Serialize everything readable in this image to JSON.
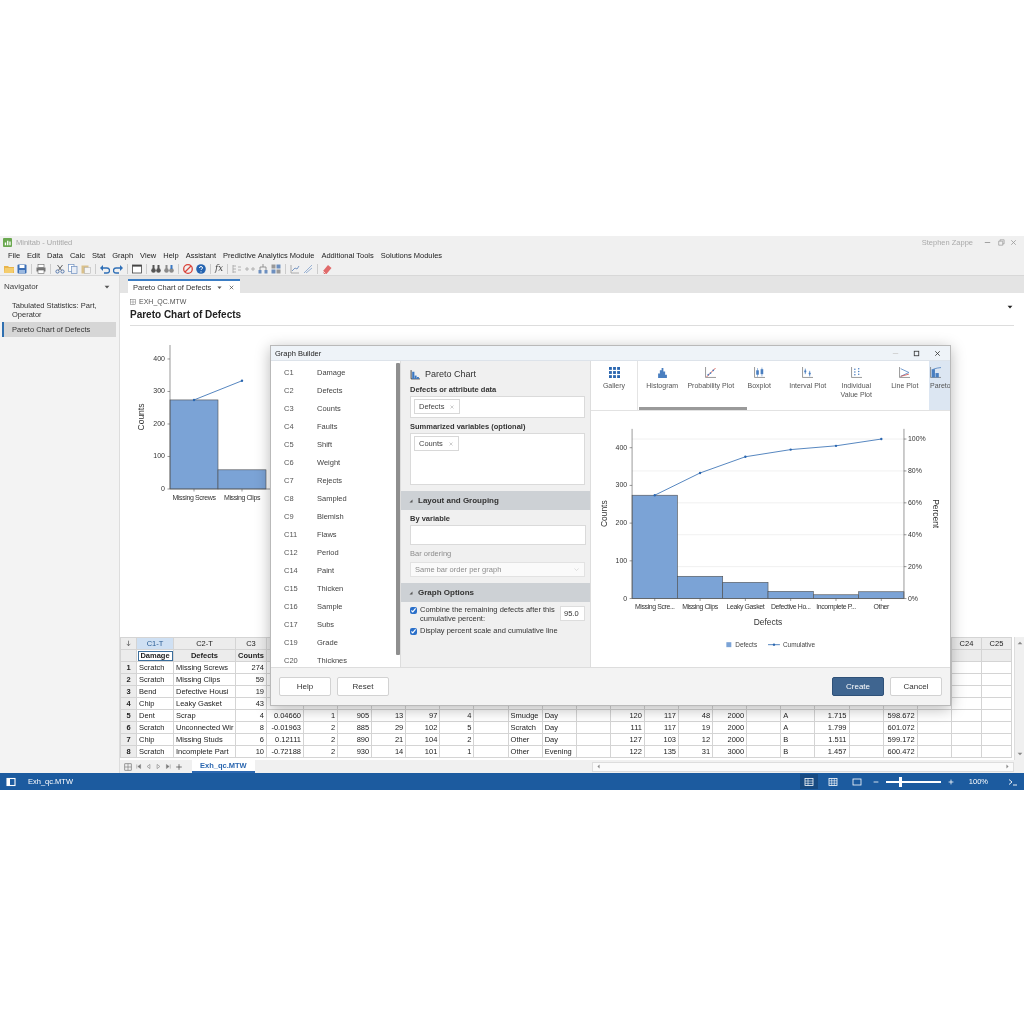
{
  "app": {
    "title": "Minitab - Untitled",
    "user": "Stephen Zappe"
  },
  "menu": [
    "File",
    "Edit",
    "Data",
    "Calc",
    "Stat",
    "Graph",
    "View",
    "Help",
    "Assistant",
    "Predictive Analytics Module",
    "Additional Tools",
    "Solutions Modules"
  ],
  "toolbar": {
    "formula_label": "fx"
  },
  "navigator": {
    "title": "Navigator",
    "items": [
      {
        "label": "Tabulated Statistics: Part, Operator",
        "selected": false
      },
      {
        "label": "Pareto Chart of Defects",
        "selected": true
      }
    ]
  },
  "output_tabs": [
    {
      "label": "Pareto Chart of Defects",
      "selected": true
    }
  ],
  "output": {
    "source": "EXH_QC.MTW",
    "title": "Pareto Chart of Defects",
    "chart_data": {
      "type": "bar",
      "ylabel": "Counts",
      "categories": [
        "Missing Screws",
        "Missing Clips"
      ],
      "ylim": [
        0,
        443
      ],
      "yticks": [
        0,
        100,
        200,
        300,
        400
      ],
      "series": [
        {
          "type": "bar",
          "color": "#7ba3d6",
          "values": [
            274,
            59
          ]
        },
        {
          "type": "line",
          "color": "#2b67b0",
          "values": [
            274,
            333
          ]
        }
      ]
    }
  },
  "worksheet": {
    "columns": [
      {
        "id": "C1-T",
        "name": "Damage",
        "kind": "text",
        "selected": true
      },
      {
        "id": "C2-T",
        "name": "Defects",
        "kind": "text",
        "selected": false
      },
      {
        "id": "C3",
        "name": "Counts",
        "kind": "numeric",
        "selected": false
      },
      {
        "kind": "numeric"
      },
      {
        "kind": "numeric"
      },
      {
        "kind": "numeric"
      },
      {
        "kind": "numeric"
      },
      {
        "kind": "numeric"
      },
      {
        "kind": "numeric"
      },
      {
        "kind": "numeric"
      },
      {
        "kind": "text"
      },
      {
        "kind": "text"
      },
      {
        "kind": "numeric"
      },
      {
        "kind": "numeric"
      },
      {
        "kind": "numeric"
      },
      {
        "kind": "numeric"
      },
      {
        "kind": "numeric"
      },
      {
        "kind": "numeric"
      },
      {
        "kind": "text"
      },
      {
        "kind": "numeric"
      },
      {
        "kind": "numeric"
      },
      {
        "kind": "numeric"
      },
      {
        "kind": "numeric"
      },
      {
        "id": "C24",
        "kind": "numeric",
        "selected": false
      },
      {
        "id": "C25",
        "kind": "numeric",
        "selected": false
      }
    ],
    "rows": [
      {
        "num": "1",
        "cells": [
          "Scratch",
          "Missing Screws",
          "274"
        ]
      },
      {
        "num": "2",
        "cells": [
          "Scratch",
          "Missing Clips",
          "59"
        ]
      },
      {
        "num": "3",
        "cells": [
          "Bend",
          "Defective Housi",
          "19"
        ]
      },
      {
        "num": "4",
        "cells": [
          "Chip",
          "Leaky Gasket",
          "43"
        ]
      },
      {
        "num": "5",
        "cells": [
          "Dent",
          "Scrap",
          "4",
          "0.04660",
          "1",
          "905",
          "13",
          "97",
          "4",
          null,
          "Smudge",
          "Day",
          null,
          "120",
          "117",
          "48",
          "2000",
          null,
          "A",
          "1.715",
          null,
          "598.672"
        ]
      },
      {
        "num": "6",
        "cells": [
          "Scratch",
          "Unconnected Wir",
          "8",
          "-0.01963",
          "2",
          "885",
          "29",
          "102",
          "5",
          null,
          "Scratch",
          "Day",
          null,
          "111",
          "117",
          "19",
          "2000",
          null,
          "A",
          "1.799",
          null,
          "601.072"
        ]
      },
      {
        "num": "7",
        "cells": [
          "Chip",
          "Missing Studs",
          "6",
          "0.12111",
          "2",
          "890",
          "21",
          "104",
          "2",
          null,
          "Other",
          "Day",
          null,
          "127",
          "103",
          "12",
          "2000",
          null,
          "B",
          "1.511",
          null,
          "599.172"
        ]
      },
      {
        "num": "8",
        "cells": [
          "Scratch",
          "Incomplete Part",
          "10",
          "-0.72188",
          "2",
          "930",
          "14",
          "101",
          "1",
          null,
          "Other",
          "Evening",
          null,
          "122",
          "135",
          "31",
          "3000",
          null,
          "B",
          "1.457",
          null,
          "600.472"
        ]
      }
    ],
    "sheet_tabs": [
      {
        "label": "Exh_qc.MTW",
        "selected": true
      }
    ]
  },
  "dialog": {
    "title": "Graph Builder",
    "variables": [
      {
        "id": "C1",
        "name": "Damage"
      },
      {
        "id": "C2",
        "name": "Defects"
      },
      {
        "id": "C3",
        "name": "Counts"
      },
      {
        "id": "C4",
        "name": "Faults"
      },
      {
        "id": "C5",
        "name": "Shift"
      },
      {
        "id": "C6",
        "name": "Weight"
      },
      {
        "id": "C7",
        "name": "Rejects"
      },
      {
        "id": "C8",
        "name": "Sampled"
      },
      {
        "id": "C9",
        "name": "Blemish"
      },
      {
        "id": "C11",
        "name": "Flaws"
      },
      {
        "id": "C12",
        "name": "Period"
      },
      {
        "id": "C14",
        "name": "Paint"
      },
      {
        "id": "C15",
        "name": "Thicken"
      },
      {
        "id": "C16",
        "name": "Sample"
      },
      {
        "id": "C17",
        "name": "Subs"
      },
      {
        "id": "C19",
        "name": "Grade"
      },
      {
        "id": "C20",
        "name": "Thicknes"
      }
    ],
    "panel": {
      "title": "Pareto Chart",
      "defects_label": "Defects or attribute data",
      "defects_chips": [
        "Defects"
      ],
      "summarized_label": "Summarized variables (optional)",
      "summarized_chips": [
        "Counts"
      ],
      "layout_section": {
        "title": "Layout and Grouping",
        "expanded": true
      },
      "by_variable_label": "By variable",
      "bar_ordering": {
        "label": "Bar ordering",
        "value": "Same bar order per graph",
        "disabled": true
      },
      "options_section": {
        "title": "Graph Options",
        "expanded": true
      },
      "options": [
        {
          "label": "Combine the remaining defects after this cumulative percent:",
          "checked": true,
          "value": "95.0"
        },
        {
          "label": "Display percent scale and cumulative line",
          "checked": true
        }
      ]
    },
    "gallery": [
      {
        "label": "Gallery",
        "kind": "gallery",
        "selected": false
      },
      {
        "label": "Histogram",
        "kind": "histogram",
        "selected": false
      },
      {
        "label": "Probability Plot",
        "kind": "probability",
        "selected": false
      },
      {
        "label": "Boxplot",
        "kind": "boxplot",
        "selected": false
      },
      {
        "label": "Interval Plot",
        "kind": "interval",
        "selected": false
      },
      {
        "label": "Individual Value Plot",
        "kind": "individual",
        "selected": false
      },
      {
        "label": "Line Plot",
        "kind": "line",
        "selected": false
      },
      {
        "label": "Pareto",
        "kind": "pareto",
        "selected": true
      }
    ],
    "preview": {
      "chart_data": {
        "type": "bar",
        "xlabel": "Defects",
        "ylabel": "Counts",
        "categories": [
          "Missing Scre...",
          "Missing Clips",
          "Leaky Gasket",
          "Defective Ho...",
          "Incomplete P...",
          "Other"
        ],
        "ylim": [
          0,
          450
        ],
        "yticks": [
          0,
          100,
          200,
          300,
          400
        ],
        "legend": "bottom",
        "series": [
          {
            "name": "Defects",
            "type": "bar",
            "color": "#7ba3d6",
            "values": [
              274,
              59,
              43,
              19,
              10,
              18
            ]
          },
          {
            "name": "Cumulative",
            "type": "line",
            "color": "#2b67b0",
            "values": [
              274,
              333,
              376,
              395,
              405,
              423
            ]
          }
        ]
      },
      "secondary_axis": {
        "label": "Percent",
        "ticks": [
          "100%",
          "80%",
          "60%",
          "40%",
          "20%",
          "0%"
        ]
      }
    },
    "left_buttons": [
      "Help",
      "Reset"
    ],
    "right_buttons": [
      {
        "label": "Create",
        "kind": "primary"
      },
      {
        "label": "Cancel",
        "kind": "secondary"
      }
    ]
  },
  "status_bar": {
    "file": "Exh_qc.MTW",
    "zoom_slider": {
      "level": 0.25
    },
    "zoom": "100%"
  }
}
